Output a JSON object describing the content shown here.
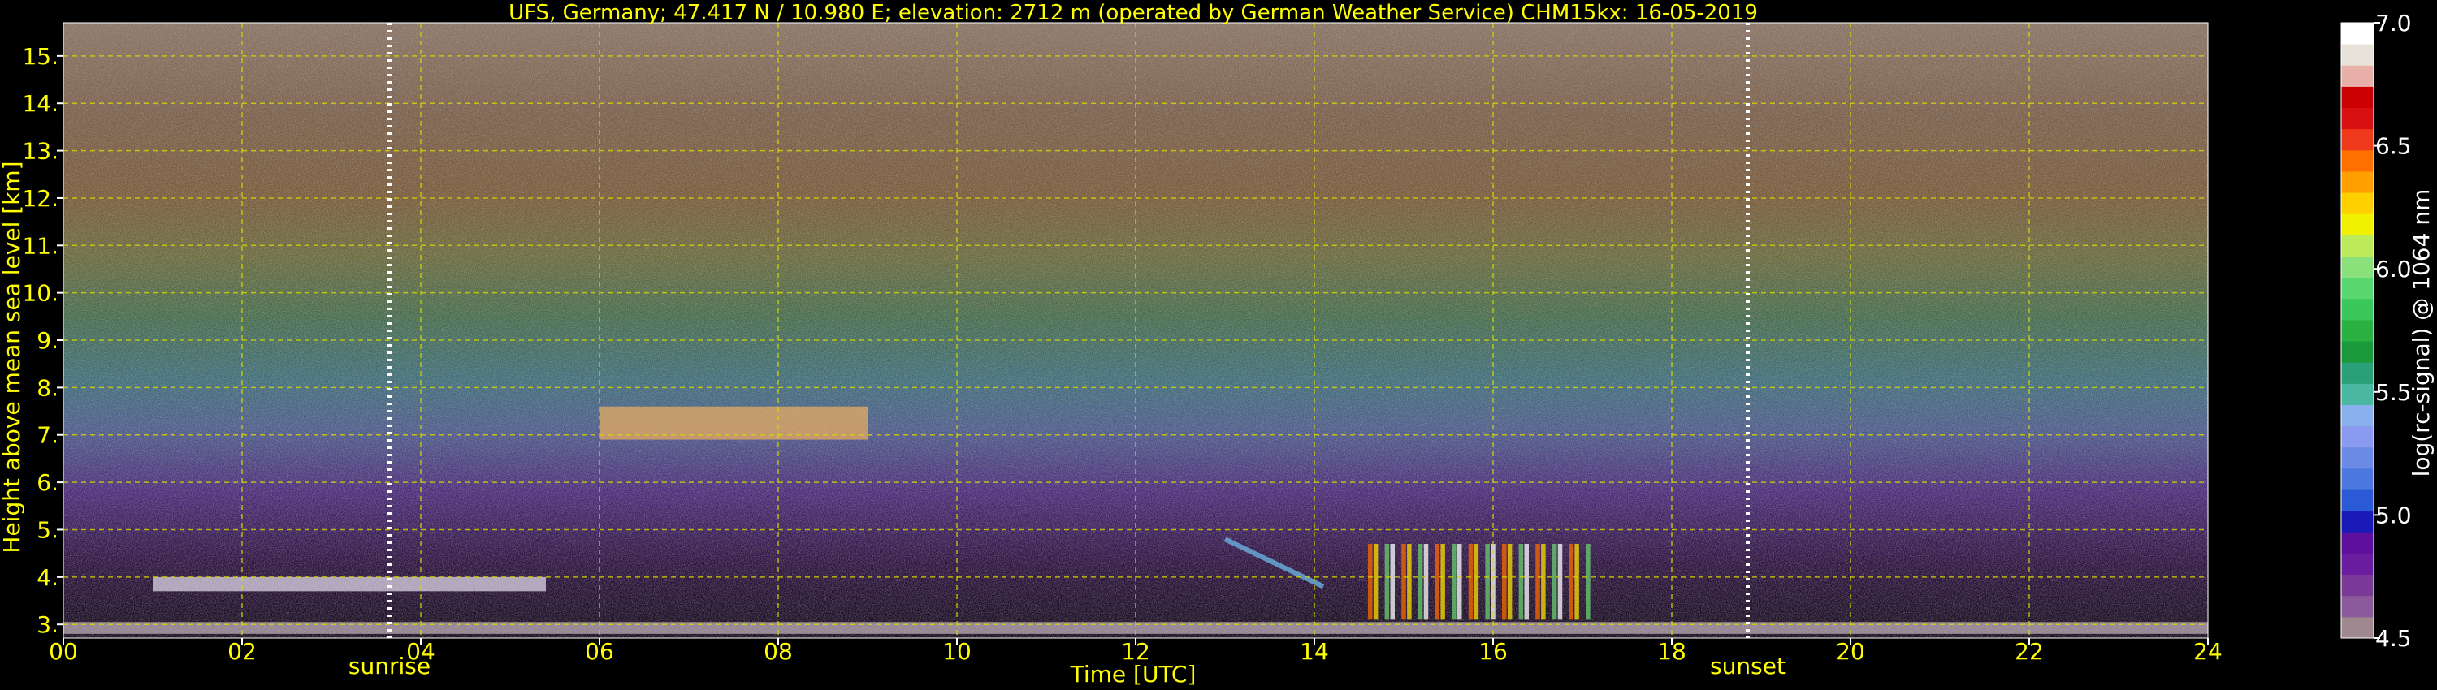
{
  "chart_data": {
    "type": "heatmap",
    "title": "UFS, Germany; 47.417 N / 10.980 E; elevation: 2712 m  (operated by German Weather Service)    CHM15kx: 16-05-2019",
    "xlabel": "Time [UTC]",
    "ylabel": "Height above mean sea level [km]",
    "xlim": [
      0,
      24
    ],
    "ylim": [
      2.712,
      15.7
    ],
    "xticks": [
      "00",
      "02",
      "04",
      "06",
      "08",
      "10",
      "12",
      "14",
      "16",
      "18",
      "20",
      "22",
      "24"
    ],
    "xtick_values": [
      0,
      2,
      4,
      6,
      8,
      10,
      12,
      14,
      16,
      18,
      20,
      22,
      24
    ],
    "yticks": [
      "3.",
      "4.",
      "5.",
      "6.",
      "7.",
      "8.",
      "9.",
      "10.",
      "11.",
      "12.",
      "13.",
      "14.",
      "15."
    ],
    "ytick_values": [
      3,
      4,
      5,
      6,
      7,
      8,
      9,
      10,
      11,
      12,
      13,
      14,
      15
    ],
    "grid": true,
    "markers": [
      {
        "name": "sunrise",
        "x": 3.65
      },
      {
        "name": "sunset",
        "x": 18.85
      }
    ],
    "colorbar": {
      "label": "log(rc-signal) @ 1064 nm",
      "range": [
        4.5,
        7.0
      ],
      "ticks": [
        "4.5",
        "5.0",
        "5.5",
        "6.0",
        "6.5",
        "7.0"
      ],
      "tick_values": [
        4.5,
        5.0,
        5.5,
        6.0,
        6.5,
        7.0
      ],
      "colors": [
        "#a08890",
        "#8c5a9a",
        "#7a3a98",
        "#6a1d9e",
        "#5e0f9c",
        "#1a1ab8",
        "#2a5ad6",
        "#4a78de",
        "#6a8ae6",
        "#8a9aee",
        "#8ab0ee",
        "#4ab8a0",
        "#2aa078",
        "#1a9a3a",
        "#2ab040",
        "#3ac85a",
        "#5ad870",
        "#8ae07a",
        "#bcea5a",
        "#f0f000",
        "#ffd000",
        "#ffa000",
        "#ff7000",
        "#ee3a1a",
        "#d81010",
        "#cc0000",
        "#e8b0a8",
        "#e8e2d8",
        "#ffffff"
      ]
    },
    "features": [
      {
        "name": "boundary layer",
        "x": [
          0,
          24
        ],
        "height_km": [
          2.8,
          3.05
        ]
      },
      {
        "name": "cloud layer",
        "x": [
          1,
          5.4
        ],
        "height_km": [
          3.7,
          4.0
        ]
      },
      {
        "name": "cirrus patches",
        "x": [
          6.0,
          9.0
        ],
        "height_km": [
          6.9,
          7.6
        ]
      },
      {
        "name": "convective cloud columns",
        "x": [
          14.6,
          17.1
        ],
        "height_km": [
          3.1,
          4.7
        ]
      },
      {
        "name": "slanted feature",
        "x": [
          13.0,
          14.1
        ],
        "height_km": [
          3.8,
          4.8
        ]
      }
    ]
  }
}
